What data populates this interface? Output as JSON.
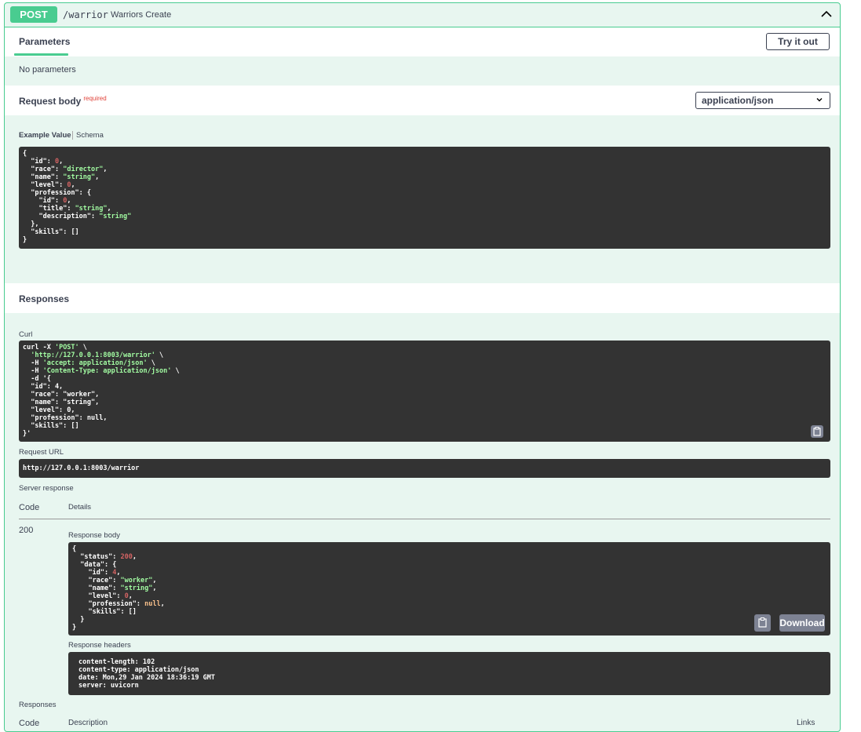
{
  "operation": {
    "method": "POST",
    "path": "/warrior",
    "summary": "Warriors Create"
  },
  "tabs": {
    "parameters": "Parameters"
  },
  "buttons": {
    "try_it_out": "Try it out",
    "download": "Download"
  },
  "parameters": {
    "empty_text": "No parameters"
  },
  "request_body": {
    "title": "Request body",
    "required": "required",
    "content_type": "application/json",
    "example_value_tab": "Example Value",
    "schema_tab": "Schema"
  },
  "responses_title": "Responses",
  "curl": {
    "label": "Curl",
    "lines": [
      "curl -X 'POST' \\",
      "  'http://127.0.0.1:8003/warrior' \\",
      "  -H 'accept: application/json' \\",
      "  -H 'Content-Type: application/json' \\",
      "  -d '{",
      "  \"id\": 4,",
      "  \"race\": \"worker\",",
      "  \"name\": \"string\",",
      "  \"level\": 0,",
      "  \"profession\": null,",
      "  \"skills\": []",
      "}'"
    ]
  },
  "request_url": {
    "label": "Request URL",
    "value": "http://127.0.0.1:8003/warrior"
  },
  "server_response": {
    "label": "Server response",
    "code_header": "Code",
    "details_header": "Details",
    "code": "200",
    "body_label": "Response body",
    "headers_label": "Response headers",
    "headers": [
      "content-length: 102",
      "content-type: application/json",
      "date: Mon,29 Jan 2024 18:36:19 GMT",
      "server: uvicorn"
    ]
  },
  "responses_bottom": {
    "title": "Responses",
    "code_header": "Code",
    "description_header": "Description",
    "links_header": "Links"
  },
  "icons": {
    "collapse": "chevron-up-icon",
    "select": "chevron-down-icon",
    "copy": "clipboard-icon"
  },
  "colors": {
    "post_green": "#49cc90",
    "post_bg": "#e8f6f0",
    "code_bg": "#333333",
    "required_red": "#e0433a"
  }
}
